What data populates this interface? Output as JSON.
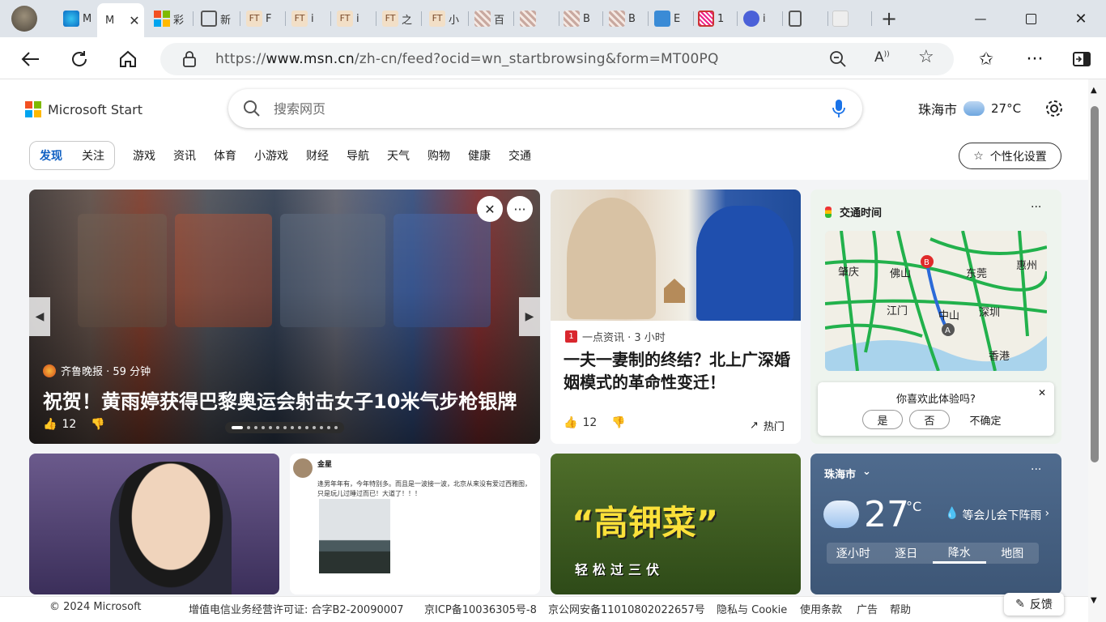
{
  "tabs": [
    {
      "label": "M",
      "active": false,
      "icon": "profile-avatar"
    },
    {
      "label": "M",
      "active": true,
      "icon": "edge-icon"
    },
    {
      "label": "彩",
      "icon": "windows-store-icon"
    },
    {
      "label": "新",
      "icon": "calendar-icon"
    },
    {
      "label": "F",
      "icon": "ft-icon"
    },
    {
      "label": "i",
      "icon": "ft-icon"
    },
    {
      "label": "i",
      "icon": "ft-icon"
    },
    {
      "label": "之",
      "icon": "ft-icon"
    },
    {
      "label": "小",
      "icon": "ft-icon"
    },
    {
      "label": "百",
      "icon": "pattern-icon"
    },
    {
      "label": "",
      "icon": "pattern-icon"
    },
    {
      "label": "B",
      "icon": "pattern-icon"
    },
    {
      "label": "B",
      "icon": "pattern-icon"
    },
    {
      "label": "E",
      "icon": "outlook-icon"
    },
    {
      "label": "1",
      "icon": "stripe-icon"
    },
    {
      "label": "i",
      "icon": "baidu-icon"
    },
    {
      "label": "",
      "icon": "document-icon"
    },
    {
      "label": "",
      "icon": "people-icon"
    }
  ],
  "address": {
    "url_prefix": "https://",
    "url_host": "www.msn.cn",
    "url_path": "/zh-cn/feed?ocid=wn_startbrowsing&form=MT00PQ"
  },
  "header": {
    "brand": "Microsoft Start",
    "search_placeholder": "搜索网页",
    "city": "珠海市",
    "temp": "27°C"
  },
  "nav": {
    "discover": "发现",
    "follow": "关注",
    "items": [
      "游戏",
      "资讯",
      "体育",
      "小游戏",
      "财经",
      "导航",
      "天气",
      "购物",
      "健康",
      "交通"
    ],
    "personalize": "个性化设置"
  },
  "hero": {
    "source": "齐鲁晚报 · 59 分钟",
    "title": "祝贺！黄雨婷获得巴黎奥运会射击女子10米气步枪银牌",
    "likes": "12"
  },
  "card2": {
    "source": "一点资讯 · 3 小时",
    "title": "一夫一妻制的终结？北上广深婚姻模式的革命性变迁！",
    "likes": "12",
    "hot": "热门"
  },
  "traffic": {
    "title": "交通时间",
    "places": [
      "肇庆",
      "佛山",
      "东莞",
      "惠州",
      "江门",
      "中山",
      "深圳",
      "香港"
    ],
    "roads": [
      "G94",
      "S16",
      "S2",
      "S18",
      "S21",
      "S14",
      "G15",
      "S49",
      "S32"
    ],
    "feedback_q": "你喜欢此体验吗?",
    "yes": "是",
    "no": "否",
    "unsure": "不确定"
  },
  "card5": {
    "overlay": "“高钾菜”",
    "sub": "轻松过三伏"
  },
  "weibo": {
    "user": "金星",
    "text": "逢男年年有，今年特别多。而且是一波接一波，北京从来没有爱过西雅图，只是玩儿过睡过而已！大道了！！！"
  },
  "weather": {
    "city": "珠海市",
    "temp": "27",
    "unit": "°C",
    "note": "等会儿会下阵雨",
    "tabs": [
      "逐小时",
      "逐日",
      "降水",
      "地图"
    ],
    "selected_tab": "降水"
  },
  "footer": {
    "copyright": "© 2024 Microsoft",
    "license": "增值电信业务经营许可证: 合字B2-20090007",
    "icp": "京ICP备10036305号-8",
    "police": "京公网安备11010802022657号",
    "privacy": "隐私与 Cookie",
    "terms": "使用条款",
    "ads": "广告",
    "help": "帮助",
    "feedback": "反馈"
  }
}
